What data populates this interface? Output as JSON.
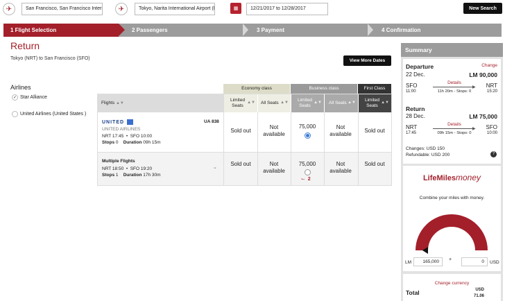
{
  "search": {
    "origin": "San Francisco, San Francisco Interna",
    "destination": "Tokyo, Narita International Airport (NI",
    "dates": "12/21/2017 to 12/28/2017",
    "new_search": "New Search"
  },
  "steps": [
    "1 Flight Selection",
    "2 Passengers",
    "3 Payment",
    "4 Confirmation"
  ],
  "main": {
    "title": "Return",
    "route": "Tokyo (NRT) to San Francisco (SFO)",
    "view_more": "View More Dates"
  },
  "filters": {
    "heading": "Airlines",
    "options": [
      {
        "label": "Star Alliance",
        "checked": true
      },
      {
        "label": "United Airlines (United States )",
        "checked": false
      }
    ]
  },
  "table": {
    "class_headers": {
      "economy": "Economy class",
      "business": "Business class",
      "first": "First Class"
    },
    "col_headers": {
      "flights": "Flights",
      "limited1": "Limited",
      "limited2": "Seats",
      "all_seats": "All Seats"
    },
    "rows": [
      {
        "logo": "UNITED",
        "airline": "UNITED AIRLINES",
        "flight_no": "UA 838",
        "dep": "NRT 17:45",
        "arr": "SFO 10:00",
        "stops_label": "Stops",
        "stops": "0",
        "duration_label": "Duration",
        "duration": "09h 15m",
        "econ_limited": "Sold out",
        "econ_all": "Not available",
        "bus_limited": "75,000",
        "bus_all": "Not available",
        "first_limited": "Sold out"
      },
      {
        "name": "Multiple Flights",
        "dep": "NRT 18:50",
        "arr": "SFO 19:20",
        "stops_label": "Stops",
        "stops": "1",
        "duration_label": "Duration",
        "duration": "17h 30m",
        "econ_limited": "Sold out",
        "econ_all": "Not available",
        "bus_limited": "75,000",
        "bus_seats_left": "2",
        "bus_all": "Not available",
        "first_limited": "Sold out"
      }
    ]
  },
  "summary": {
    "heading": "Summary",
    "departure": {
      "label": "Departure",
      "change": "Change",
      "date": "22 Dec.",
      "miles": "LM 90,000",
      "from": "SFO",
      "from_time": "11:00",
      "details": "Details",
      "info": "11h 20m - Stops: 0",
      "to": "NRT",
      "to_time": "15:20"
    },
    "return": {
      "label": "Return",
      "date": "28 Dec.",
      "miles": "LM 75,000",
      "from": "NRT",
      "from_time": "17:45",
      "details": "Details",
      "info": "09h 15m - Stops: 0",
      "to": "SFO",
      "to_time": "10:00"
    },
    "changes": "Changes: USD 150",
    "refundable": "Refundable: USD 200",
    "help": "?",
    "lifemiles_logo": "LifeMiles",
    "lifemiles_money": "money",
    "combine": "Combine your miles with money.",
    "lm_label": "LM",
    "lm_value": "165,000",
    "plus": "+",
    "usd_value": "0",
    "usd_label": "USD",
    "change_currency": "Change currency",
    "total_label": "Total",
    "total_currency": "USD",
    "total_value": "71.06"
  },
  "colors": {
    "accent": "#a31f2a",
    "dark": "#111111",
    "grey": "#9c9c9c"
  }
}
